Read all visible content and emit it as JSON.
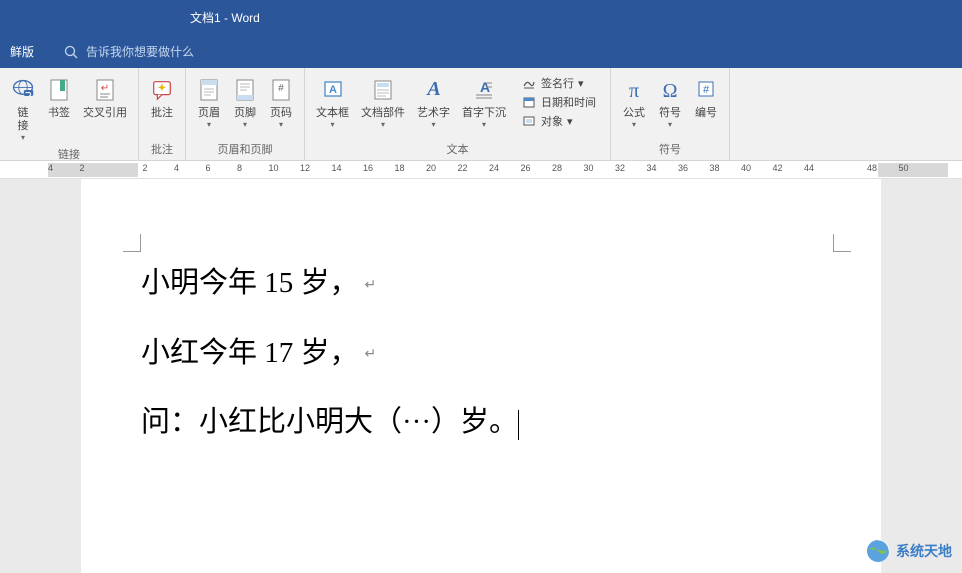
{
  "titlebar": {
    "title": "文档1  -  Word"
  },
  "searchbar": {
    "tab_label": "鲜版",
    "search_placeholder": "告诉我你想要做什么"
  },
  "ribbon": {
    "groups": [
      {
        "label": "链接",
        "buttons": [
          {
            "name": "link-button",
            "label": "链\n接"
          },
          {
            "name": "bookmark-button",
            "label": "书签"
          },
          {
            "name": "crossref-button",
            "label": "交叉引用"
          }
        ]
      },
      {
        "label": "批注",
        "buttons": [
          {
            "name": "comment-button",
            "label": "批注"
          }
        ]
      },
      {
        "label": "页眉和页脚",
        "buttons": [
          {
            "name": "header-button",
            "label": "页眉"
          },
          {
            "name": "footer-button",
            "label": "页脚"
          },
          {
            "name": "pagenum-button",
            "label": "页码"
          }
        ]
      },
      {
        "label": "文本",
        "buttons": [
          {
            "name": "textbox-button",
            "label": "文本框"
          },
          {
            "name": "docparts-button",
            "label": "文档部件"
          },
          {
            "name": "wordart-button",
            "label": "艺术字"
          },
          {
            "name": "dropcap-button",
            "label": "首字下沉"
          }
        ],
        "stack": [
          {
            "name": "signature-line-button",
            "label": "签名行"
          },
          {
            "name": "datetime-button",
            "label": "日期和时间"
          },
          {
            "name": "object-button",
            "label": "对象"
          }
        ]
      },
      {
        "label": "符号",
        "buttons": [
          {
            "name": "equation-button",
            "label": "公式"
          },
          {
            "name": "symbol-button",
            "label": "符号"
          },
          {
            "name": "number-button",
            "label": "编号"
          }
        ]
      }
    ]
  },
  "ruler": {
    "ticks": [
      "4",
      "2",
      "",
      "2",
      "4",
      "6",
      "8",
      "10",
      "12",
      "14",
      "16",
      "18",
      "20",
      "22",
      "24",
      "26",
      "28",
      "30",
      "32",
      "34",
      "36",
      "38",
      "40",
      "42",
      "44",
      "",
      "48",
      "50"
    ]
  },
  "document": {
    "lines": [
      "小明今年 15 岁，",
      "小红今年 17 岁，",
      "问：小红比小明大（···）岁。"
    ]
  },
  "watermark": {
    "text": "系统天地"
  }
}
